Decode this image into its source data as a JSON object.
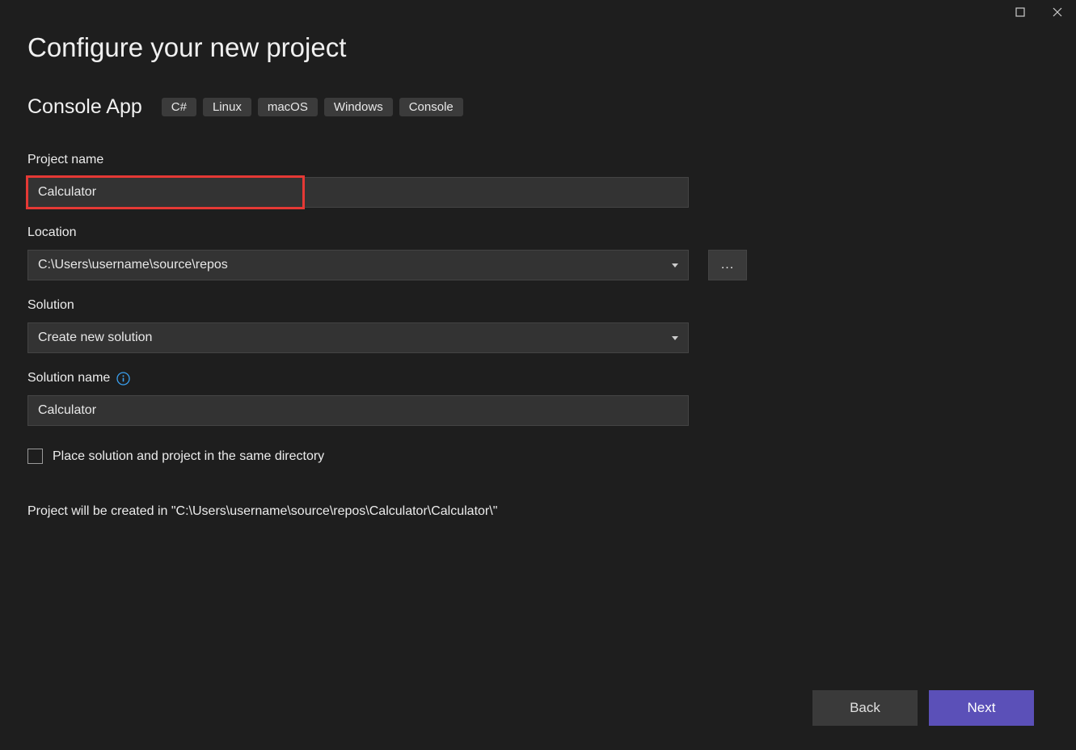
{
  "title": "Configure your new project",
  "projectType": {
    "name": "Console App",
    "tags": [
      "C#",
      "Linux",
      "macOS",
      "Windows",
      "Console"
    ]
  },
  "fields": {
    "projectName": {
      "label": "Project name",
      "value": "Calculator"
    },
    "location": {
      "label": "Location",
      "value": "C:\\Users\\username\\source\\repos",
      "browseLabel": "..."
    },
    "solution": {
      "label": "Solution",
      "value": "Create new solution"
    },
    "solutionName": {
      "label": "Solution name",
      "value": "Calculator"
    }
  },
  "checkbox": {
    "label": "Place solution and project in the same directory",
    "checked": false
  },
  "statusText": "Project will be created in \"C:\\Users\\username\\source\\repos\\Calculator\\Calculator\\\"",
  "buttons": {
    "back": "Back",
    "next": "Next"
  }
}
